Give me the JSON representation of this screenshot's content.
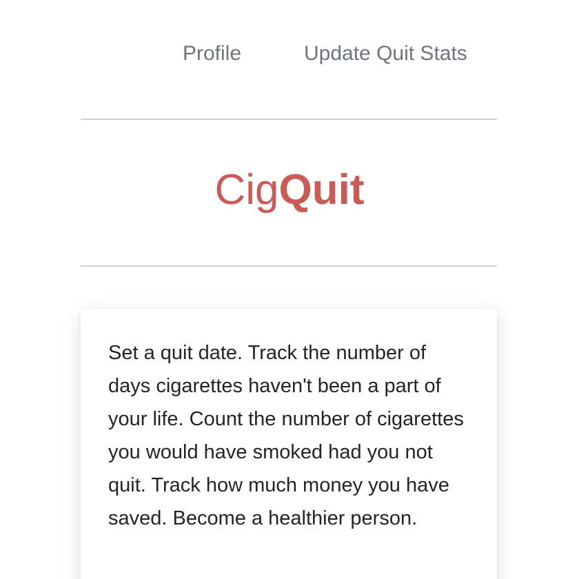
{
  "nav": {
    "profile_label": "Profile",
    "update_label": "Update Quit Stats"
  },
  "brand": {
    "part_light": "Cig",
    "part_bold": "Quit",
    "color": "#cc5b55"
  },
  "card": {
    "description": "Set a quit date. Track the number of days cigarettes haven't been a part of your life. Count the number of cigarettes you would have smoked had you not quit. Track how much money you have saved. Become a healthier person."
  },
  "colors": {
    "nav_text": "#6c757d",
    "body_text": "#212529",
    "divider": "#d0d0d0"
  }
}
